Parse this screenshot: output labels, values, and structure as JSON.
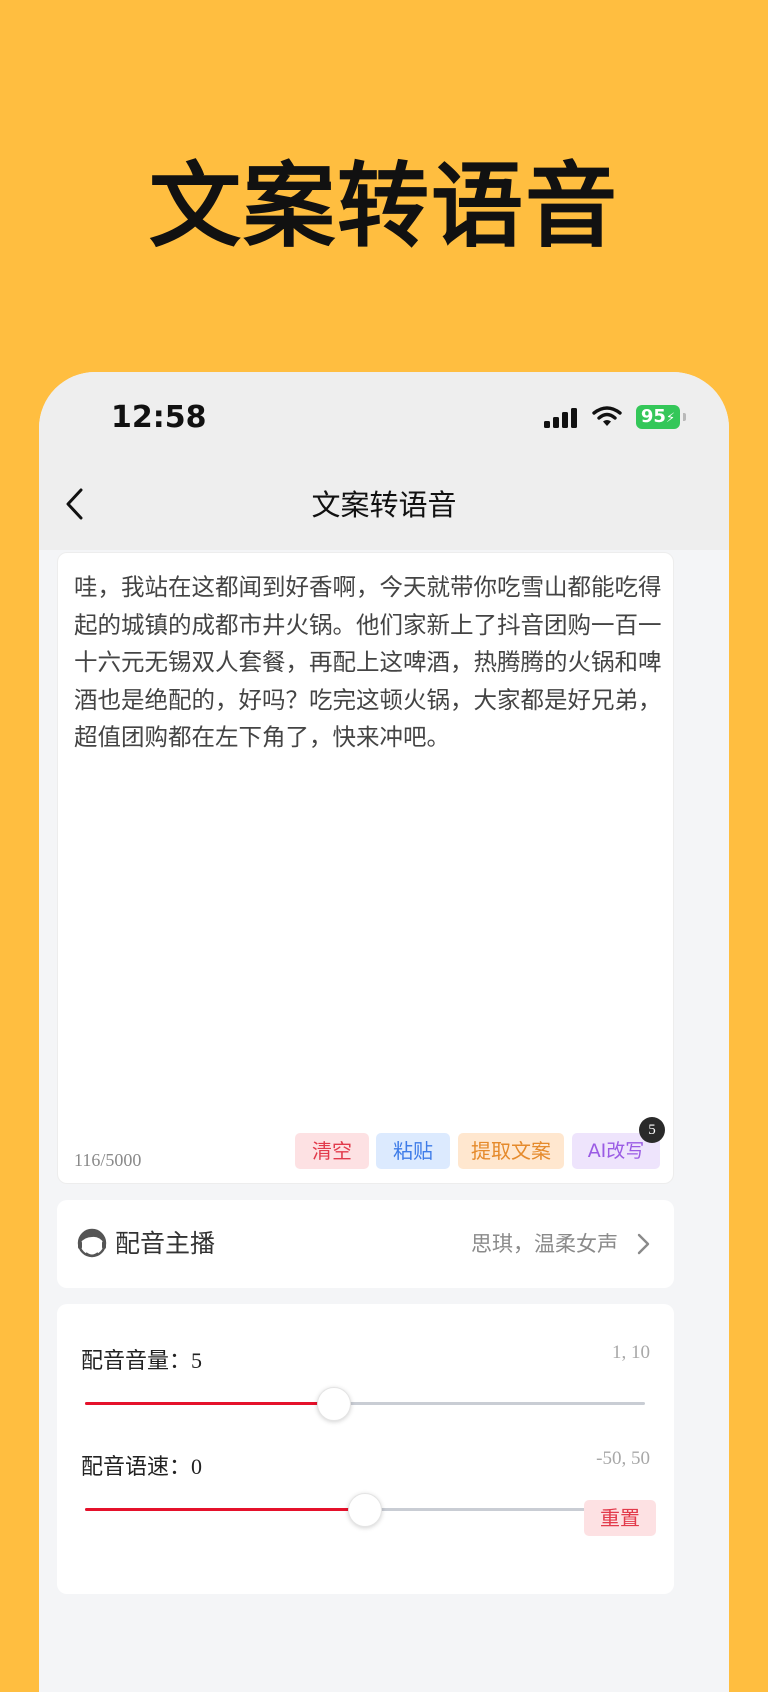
{
  "promo": {
    "title": "文案转语音"
  },
  "status_bar": {
    "time": "12:58",
    "battery": "95"
  },
  "nav": {
    "title": "文案转语音"
  },
  "editor": {
    "text": "哇，我站在这都闻到好香啊，今天就带你吃雪山都能吃得起的城镇的成都市井火锅。他们家新上了抖音团购一百一十六元无锡双人套餐，再配上这啤酒，热腾腾的火锅和啤酒也是绝配的，好吗？吃完这顿火锅，大家都是好兄弟，超值团购都在左下角了，快来冲吧。",
    "char_count": "116/5000",
    "actions": {
      "clear": "清空",
      "paste": "粘贴",
      "extract": "提取文案",
      "ai_rewrite": "AI改写",
      "ai_badge": "5"
    }
  },
  "voice": {
    "label": "配音主播",
    "value": "思琪，温柔女声"
  },
  "settings": {
    "volume": {
      "label": "配音音量：",
      "value": "5",
      "range": "1, 10",
      "min": 1,
      "max": 10,
      "current": 5
    },
    "speed": {
      "label": "配音语速：",
      "value": "0",
      "range": "-50, 50",
      "min": -50,
      "max": 50,
      "current": 0
    },
    "reset": "重置"
  },
  "colors": {
    "accent": "#E5112B",
    "background": "#FFBE40"
  }
}
